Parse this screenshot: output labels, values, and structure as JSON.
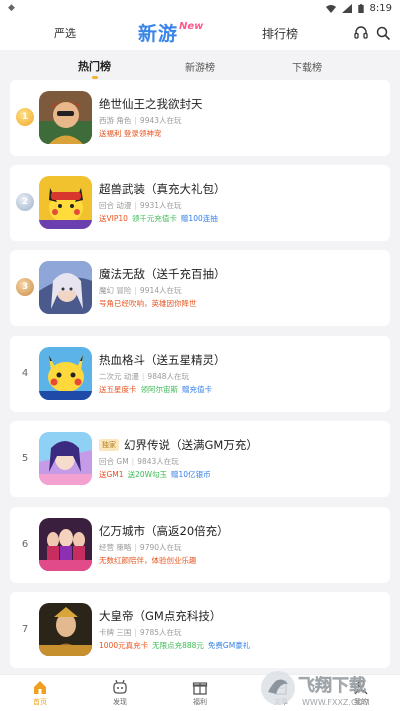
{
  "status": {
    "time": "8:19"
  },
  "header": {
    "tab_left": "严选",
    "logo_text": "新游",
    "logo_badge": "New",
    "tab_right": "排行榜",
    "headset_icon": "headset-icon",
    "search_icon": "search-icon"
  },
  "subtabs": [
    {
      "label": "热门榜",
      "active": true
    },
    {
      "label": "新游榜",
      "active": false
    },
    {
      "label": "下载榜",
      "active": false
    }
  ],
  "games": [
    {
      "rank": "1",
      "title": "绝世仙王之我欲封天",
      "tag": "",
      "genre": "西游 角色",
      "players": "9943人在玩",
      "promos": [
        {
          "text": "送福利 登录领神宠",
          "color": "#e8541e"
        }
      ]
    },
    {
      "rank": "2",
      "title": "超兽武装（真充大礼包）",
      "tag": "",
      "genre": "回合 动漫",
      "players": "9931人在玩",
      "promos": [
        {
          "text": "送VIP10",
          "color": "#e8541e"
        },
        {
          "text": "领千元充值卡",
          "color": "#3cba54"
        },
        {
          "text": "赠100连抽",
          "color": "#2f7ee8"
        }
      ]
    },
    {
      "rank": "3",
      "title": "魔法无敌（送千充百抽）",
      "tag": "",
      "genre": "魔幻 冒险",
      "players": "9914人在玩",
      "promos": [
        {
          "text": "号角已经吹响，英雄因你降世",
          "color": "#e8541e"
        }
      ]
    },
    {
      "rank": "4",
      "title": "热血格斗（送五星精灵）",
      "tag": "",
      "genre": "二次元 动漫",
      "players": "9848人在玩",
      "promos": [
        {
          "text": "送五星度卡",
          "color": "#e8541e"
        },
        {
          "text": "领阿尔宙斯",
          "color": "#3cba54"
        },
        {
          "text": "赠充值卡",
          "color": "#2f7ee8"
        }
      ]
    },
    {
      "rank": "5",
      "title": "幻界传说（送满GM万充）",
      "tag": "独家",
      "genre": "回合 GM",
      "players": "9843人在玩",
      "promos": [
        {
          "text": "送GM1",
          "color": "#e8541e"
        },
        {
          "text": "送20W勾玉",
          "color": "#3cba54"
        },
        {
          "text": "赠10亿银币",
          "color": "#2f7ee8"
        }
      ]
    },
    {
      "rank": "6",
      "title": "亿万城市（高返20倍充）",
      "tag": "",
      "genre": "经营 策略",
      "players": "9790人在玩",
      "promos": [
        {
          "text": "无数红颜陪伴，体验创业乐趣",
          "color": "#e8541e"
        }
      ]
    },
    {
      "rank": "7",
      "title": "大皇帝（GM点充科技）",
      "tag": "",
      "genre": "卡牌 三国",
      "players": "9785人在玩",
      "promos": [
        {
          "text": "1000元真充卡",
          "color": "#e8541e"
        },
        {
          "text": "无限点充888元",
          "color": "#3cba54"
        },
        {
          "text": "免费GM豪礼",
          "color": "#2f7ee8"
        }
      ]
    }
  ],
  "bottom_nav": [
    {
      "label": "首页",
      "icon": "home-icon",
      "active": true
    },
    {
      "label": "发现",
      "icon": "discover-icon",
      "active": false
    },
    {
      "label": "福利",
      "icon": "gift-icon",
      "active": false
    },
    {
      "label": "文章",
      "icon": "article-icon",
      "active": false
    },
    {
      "label": "我的",
      "icon": "profile-icon",
      "active": false
    }
  ],
  "watermark": {
    "text": "飞翔下载",
    "url": "WWW.FXXZ.COM"
  },
  "colors": {
    "accent": "#f0a020",
    "logo_blue": "#3a86e8",
    "logo_pink": "#ff5a8c"
  }
}
